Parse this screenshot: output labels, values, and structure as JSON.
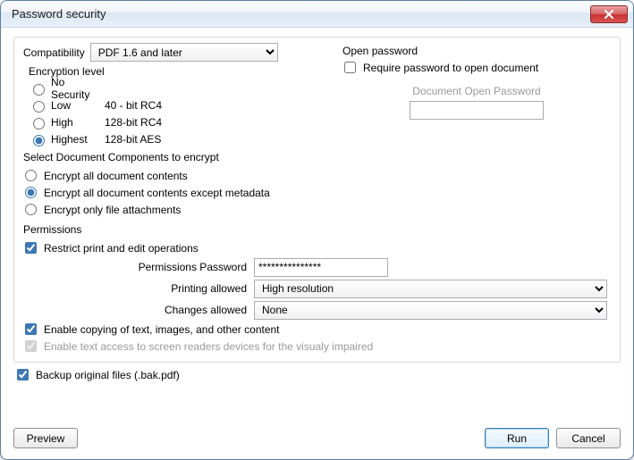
{
  "window": {
    "title": "Password security"
  },
  "compatibility": {
    "label": "Compatibility",
    "selected": "PDF 1.6 and later",
    "options": [
      "PDF 1.6 and later"
    ]
  },
  "encryption": {
    "legend": "Encryption level",
    "options": [
      {
        "name": "No Security",
        "detail": ""
      },
      {
        "name": "Low",
        "detail": "40 - bit RC4"
      },
      {
        "name": "High",
        "detail": "128-bit RC4"
      },
      {
        "name": "Highest",
        "detail": "128-bit AES"
      }
    ],
    "selected": 3
  },
  "open_password": {
    "legend": "Open password",
    "require_label": "Require password to open document",
    "require_checked": false,
    "field_label": "Document Open Password",
    "value": ""
  },
  "components": {
    "legend": "Select Document Components to encrypt",
    "options": [
      "Encrypt all document contents",
      "Encrypt all document contents except metadata",
      "Encrypt only file attachments"
    ],
    "selected": 1
  },
  "permissions": {
    "legend": "Permissions",
    "restrict_label": "Restrict print and edit operations",
    "restrict_checked": true,
    "password_label": "Permissions Password",
    "password_value": "***************",
    "printing_label": "Printing allowed",
    "printing_selected": "High resolution",
    "printing_options": [
      "High resolution"
    ],
    "changes_label": "Changes allowed",
    "changes_selected": "None",
    "changes_options": [
      "None"
    ],
    "copy_label": "Enable copying of text, images, and other content",
    "copy_checked": true,
    "access_label": "Enable text access to screen readers devices for the visualy impaired",
    "access_checked": true
  },
  "backup": {
    "label": "Backup original files (.bak.pdf)",
    "checked": true
  },
  "buttons": {
    "preview": "Preview",
    "run": "Run",
    "cancel": "Cancel"
  }
}
